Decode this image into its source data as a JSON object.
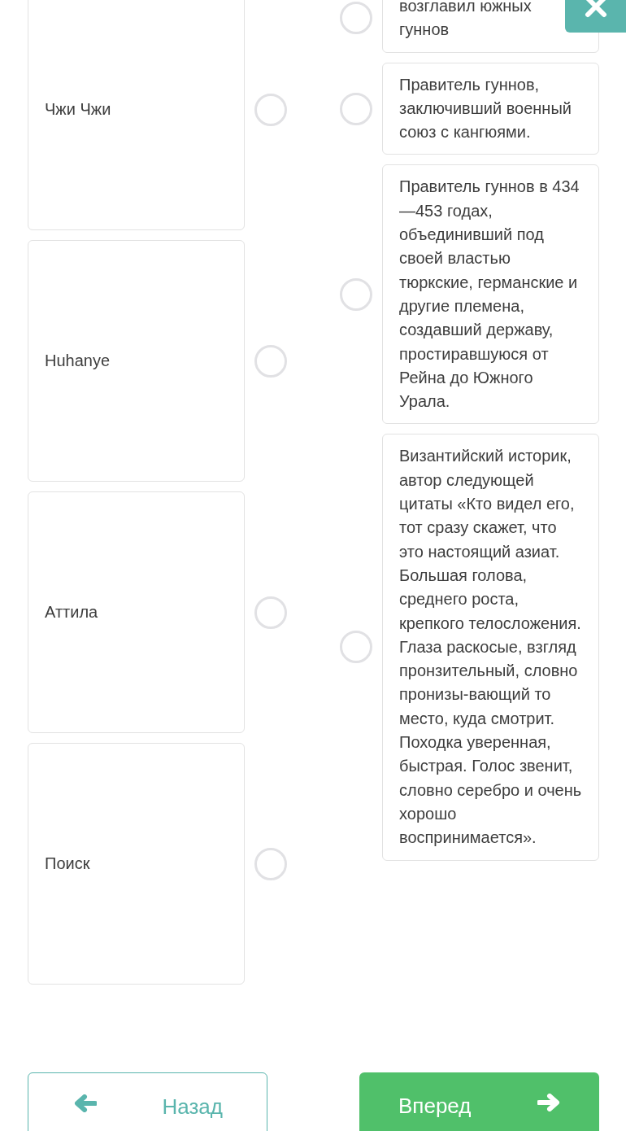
{
  "left_items": [
    {
      "label": "Чжи Чжи",
      "selected": false
    },
    {
      "label": "Huhanye",
      "selected": false
    },
    {
      "label": "Аттила",
      "selected": false
    },
    {
      "label": "Поиск",
      "selected": false
    }
  ],
  "right_items": [
    {
      "text": "возглавил южных гуннов",
      "selected": false
    },
    {
      "text": "Правитель гуннов, заключивший военный союз с кангюями.",
      "selected": false
    },
    {
      "text": "Правитель гуннов в 434—453 годах, объединивший под своей властью тюркские, германские и другие племена, создавший державу, простиравшуюся от Рейна до Южного Урала.",
      "selected": false
    },
    {
      "text": "Византийский историк, автор следующей цитаты «Кто видел его, тот сразу скажет, что это настоящий азиат. Большая голова, среднего роста, крепкого телосложения. Глаза раскосые, взгляд пронзительный, словно пронизы-вающий то место, куда смотрит. Походка уверенная, быстрая. Голос звенит, словно серебро и очень хорошо воспринимается».",
      "selected": false
    }
  ],
  "back_button": {
    "label": "Назад"
  },
  "next_button": {
    "label": "Вперед"
  }
}
